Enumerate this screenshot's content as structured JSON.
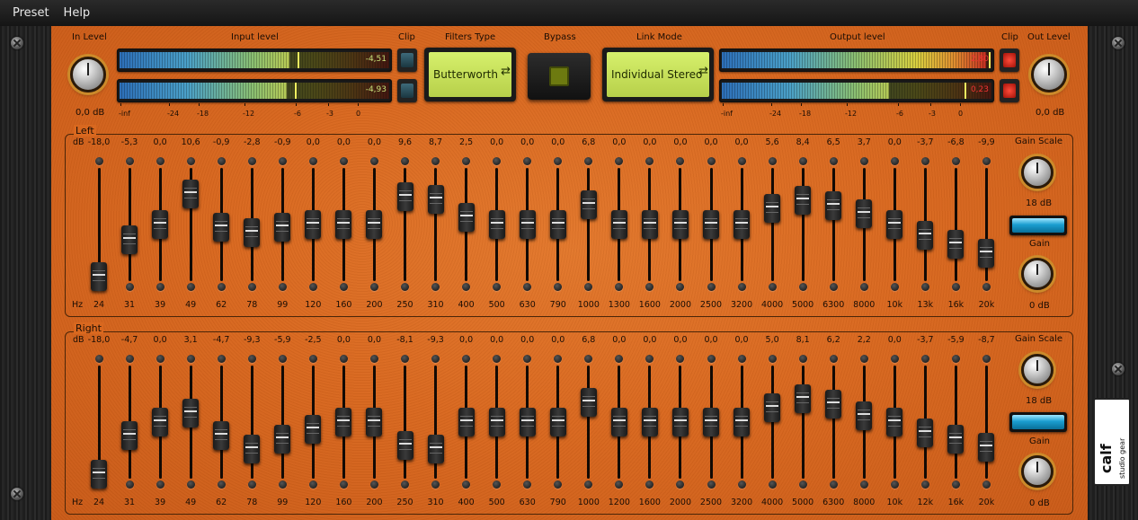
{
  "menu": [
    {
      "label": "Preset"
    },
    {
      "label": "Help"
    }
  ],
  "header": {
    "in_level_label": "In Level",
    "in_level_value": "0,0 dB",
    "input_level_label": "Input level",
    "clip_label": "Clip",
    "filters_type_label": "Filters Type",
    "filters_type_value": "Butterworth",
    "bypass_label": "Bypass",
    "link_mode_label": "Link Mode",
    "link_mode_value": "Individual Stereo",
    "output_level_label": "Output level",
    "out_clip_label": "Clip",
    "out_level_label": "Out Level",
    "out_level_value": "0,0 dB",
    "meter_scale": [
      "-inf",
      "-24",
      "-18",
      "-12",
      "-6",
      "-3",
      "0"
    ],
    "meters": {
      "input_left": {
        "value": "-4,51",
        "level": 0.63,
        "peak": 0.66
      },
      "input_right": {
        "value": "-4,93",
        "level": 0.62,
        "peak": 0.65
      },
      "output_left": {
        "value": "2,80",
        "level": 0.98,
        "peak": 0.99,
        "clip": true
      },
      "output_right": {
        "value": "0,23",
        "level": 0.62,
        "peak": 0.9,
        "clip": true
      }
    }
  },
  "left": {
    "title": "Left",
    "db_unit": "dB",
    "hz_unit": "Hz",
    "gain_scale_label": "Gain Scale",
    "gain_scale_value": "18 dB",
    "gain_label": "Gain",
    "gain_value": "0 dB",
    "db_values": [
      "-18,0",
      "-5,3",
      "0,0",
      "10,6",
      "-0,9",
      "-2,8",
      "-0,9",
      "0,0",
      "0,0",
      "0,0",
      "9,6",
      "8,7",
      "2,5",
      "0,0",
      "0,0",
      "0,0",
      "6,8",
      "0,0",
      "0,0",
      "0,0",
      "0,0",
      "0,0",
      "5,6",
      "8,4",
      "6,5",
      "3,7",
      "0,0",
      "-3,7",
      "-6,8",
      "-9,9"
    ],
    "hz_values": [
      "24",
      "31",
      "39",
      "49",
      "62",
      "78",
      "99",
      "120",
      "160",
      "200",
      "250",
      "310",
      "400",
      "500",
      "630",
      "790",
      "1000",
      "1300",
      "1600",
      "2000",
      "2500",
      "3200",
      "4000",
      "5000",
      "6300",
      "8000",
      "10k",
      "13k",
      "16k",
      "20k"
    ]
  },
  "right": {
    "title": "Right",
    "db_unit": "dB",
    "hz_unit": "Hz",
    "gain_scale_label": "Gain Scale",
    "gain_scale_value": "18 dB",
    "gain_label": "Gain",
    "gain_value": "0 dB",
    "db_values": [
      "-18,0",
      "-4,7",
      "0,0",
      "3,1",
      "-4,7",
      "-9,3",
      "-5,9",
      "-2,5",
      "0,0",
      "0,0",
      "-8,1",
      "-9,3",
      "0,0",
      "0,0",
      "0,0",
      "0,0",
      "6,8",
      "0,0",
      "0,0",
      "0,0",
      "0,0",
      "0,0",
      "5,0",
      "8,1",
      "6,2",
      "2,2",
      "0,0",
      "-3,7",
      "-5,9",
      "-8,7"
    ],
    "hz_values": [
      "24",
      "31",
      "39",
      "49",
      "62",
      "78",
      "99",
      "120",
      "160",
      "200",
      "250",
      "310",
      "400",
      "500",
      "630",
      "790",
      "1000",
      "1200",
      "1600",
      "2000",
      "2500",
      "3200",
      "4000",
      "5000",
      "6300",
      "8000",
      "10k",
      "12k",
      "16k",
      "20k"
    ]
  },
  "logo": {
    "text": "calf",
    "subtext": "studio gear"
  },
  "colors": {
    "panel": "#d9681f",
    "lcd": "#c8e05a",
    "meter_led": "#1a9ed0",
    "clip_on": "#e33"
  }
}
